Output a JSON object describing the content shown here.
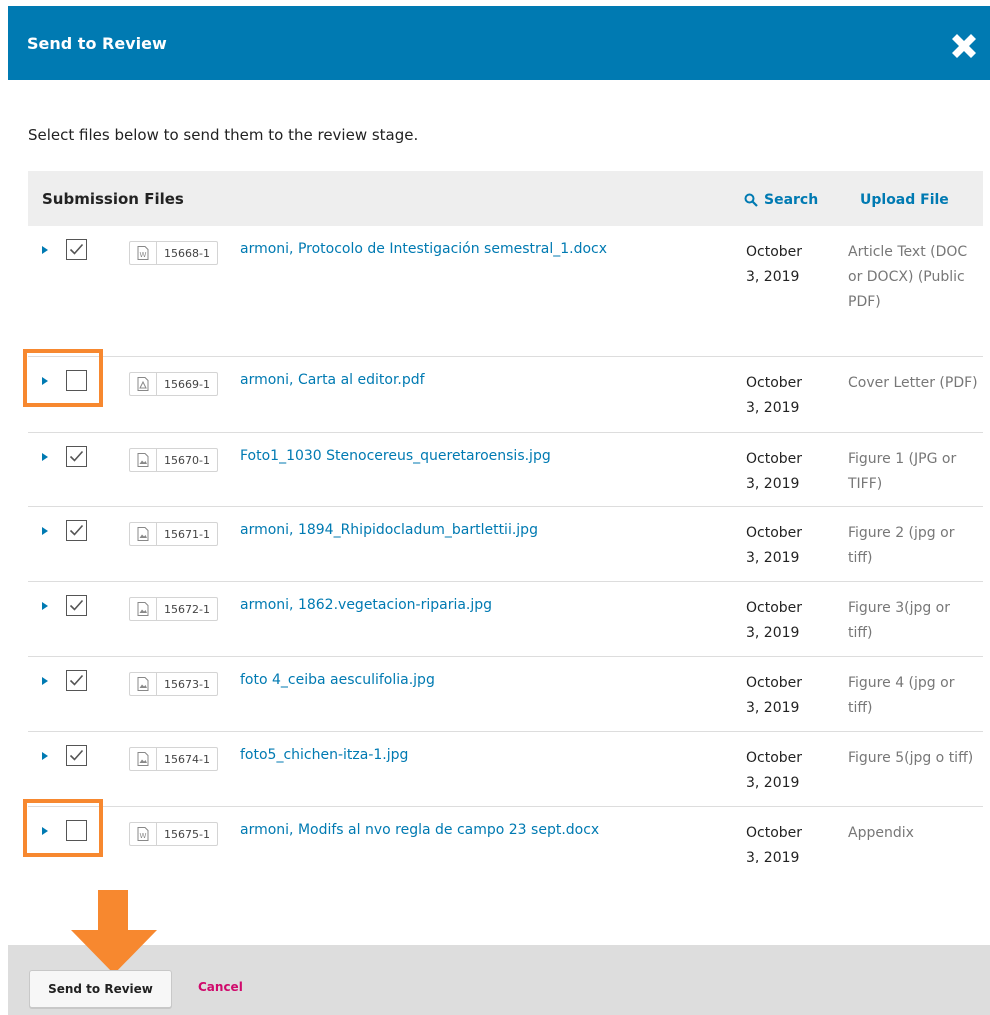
{
  "modal": {
    "title": "Send to Review",
    "intro": "Select files below to send them to the review stage.",
    "header_color": "#007ab2"
  },
  "grid": {
    "title": "Submission Files",
    "search_label": "Search",
    "upload_label": "Upload File"
  },
  "files": [
    {
      "checked": true,
      "icon": "word-file-icon",
      "id": "15668-1",
      "name": "armoni, Protocolo de Intestigación semestral_1.docx",
      "date": "October 3, 2019",
      "type": "Article Text (DOC or DOCX) (Public PDF)"
    },
    {
      "checked": false,
      "icon": "pdf-file-icon",
      "id": "15669-1",
      "name": "armoni, Carta al editor.pdf",
      "date": "October 3, 2019",
      "type": "Cover Letter (PDF)"
    },
    {
      "checked": true,
      "icon": "image-file-icon",
      "id": "15670-1",
      "name": "Foto1_1030 Stenocereus_queretaroensis.jpg",
      "date": "October 3, 2019",
      "type": "Figure 1 (JPG or TIFF)"
    },
    {
      "checked": true,
      "icon": "image-file-icon",
      "id": "15671-1",
      "name": "armoni, 1894_Rhipidocladum_bartlettii.jpg",
      "date": "October 3, 2019",
      "type": "Figure 2 (jpg or tiff)"
    },
    {
      "checked": true,
      "icon": "image-file-icon",
      "id": "15672-1",
      "name": "armoni, 1862.vegetacion-riparia.jpg",
      "date": "October 3, 2019",
      "type": "Figure 3(jpg or tiff)"
    },
    {
      "checked": true,
      "icon": "image-file-icon",
      "id": "15673-1",
      "name": "foto 4_ceiba aesculifolia.jpg",
      "date": "October 3, 2019",
      "type": "Figure 4 (jpg or tiff)"
    },
    {
      "checked": true,
      "icon": "image-file-icon",
      "id": "15674-1",
      "name": "foto5_chichen-itza-1.jpg",
      "date": "October 3, 2019",
      "type": "Figure 5(jpg o tiff)"
    },
    {
      "checked": false,
      "icon": "word-file-icon",
      "id": "15675-1",
      "name": "armoni, Modifs al nvo regla de campo 23 sept.docx",
      "date": "October 3, 2019",
      "type": "Appendix"
    }
  ],
  "footer": {
    "send_label": "Send to Review",
    "cancel_label": "Cancel"
  },
  "annotations": {
    "highlight_color": "#f7882f",
    "highlighted_rows": [
      1,
      7
    ]
  }
}
